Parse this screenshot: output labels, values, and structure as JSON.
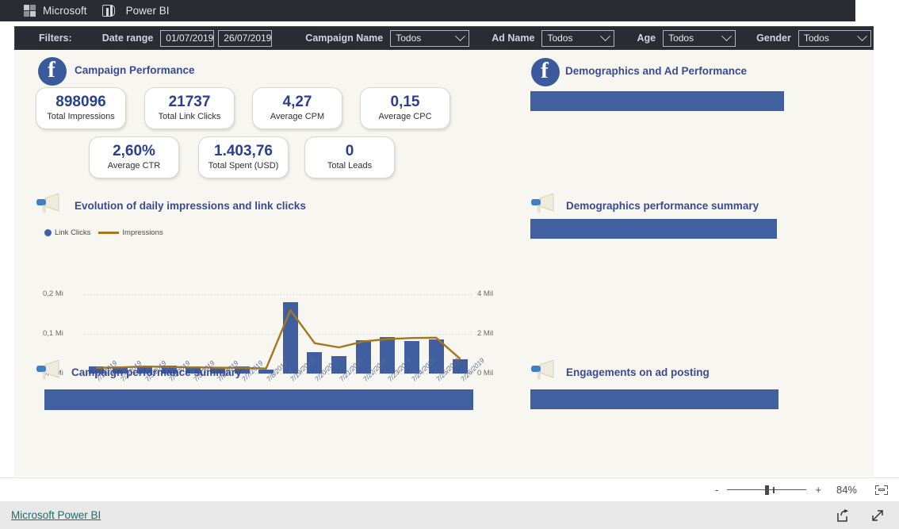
{
  "app_bar": {
    "microsoft": "Microsoft",
    "product": "Power BI",
    "ms_logo_icon": "microsoft-logo-icon",
    "pbi_icon": "power-bi-icon"
  },
  "filters": {
    "label": "Filters:",
    "date_range_label": "Date range",
    "date_from": "01/07/2019",
    "date_to": "26/07/2019",
    "campaign_name_label": "Campaign Name",
    "campaign_name_value": "Todos",
    "ad_name_label": "Ad Name",
    "ad_name_value": "Todos",
    "age_label": "Age",
    "age_value": "Todos",
    "gender_label": "Gender",
    "gender_value": "Todos"
  },
  "left": {
    "campaign_performance_title": "Campaign Performance",
    "facebook_icon": "facebook-icon",
    "kpis": [
      {
        "value": "898096",
        "label": "Total Impressions"
      },
      {
        "value": "21737",
        "label": "Total Link Clicks"
      },
      {
        "value": "4,27",
        "label": "Average CPM"
      },
      {
        "value": "0,15",
        "label": "Average CPC"
      },
      {
        "value": "2,60%",
        "label": "Average CTR"
      },
      {
        "value": "1.403,76",
        "label": "Total Spent (USD)"
      },
      {
        "value": "0",
        "label": "Total Leads"
      }
    ],
    "evolution_title": "Evolution of daily impressions and link clicks",
    "evolution_icon": "megaphone-icon",
    "campaign_summary_title": "Campaign performance summary",
    "campaign_summary_icon": "megaphone-icon"
  },
  "right": {
    "demographics_title": "Demographics and Ad Performance",
    "demographics_icon": "facebook-icon",
    "demographics_summary_title": "Demographics performance summary",
    "demographics_summary_icon": "megaphone-icon",
    "engagements_title": "Engagements on ad posting",
    "engagements_icon": "megaphone-icon"
  },
  "chart_data": {
    "type": "bar",
    "title": "Evolution of daily impressions and link clicks",
    "xlabel": "",
    "ylabel": "",
    "grid": true,
    "legend_position": "top-left",
    "legend": [
      {
        "name": "Link Clicks",
        "marker": "dot",
        "color": "#3f5fa0"
      },
      {
        "name": "Impressions",
        "marker": "line",
        "color": "#a6761d"
      }
    ],
    "categories": [
      "7/1/2019",
      "7/2/2019",
      "7/3/2019",
      "7/4/2019",
      "7/5/2019",
      "7/6/2019",
      "7/7/2019",
      "7/8/2019",
      "7/19/2019",
      "7/20/2019",
      "7/21/2019",
      "7/22/2019",
      "7/23/2019",
      "7/24/2019",
      "7/25/2019",
      "7/26/2019"
    ],
    "left_axis": {
      "ticks": [
        "0,0 Mi",
        "0,1 Mi",
        "0,2 Mi"
      ],
      "values": [
        0,
        100000,
        200000
      ],
      "ylim": [
        0,
        230000
      ]
    },
    "right_axis": {
      "ticks": [
        "0 Mil",
        "2 Mil",
        "4 Mil"
      ],
      "values": [
        0,
        2000000,
        4000000
      ],
      "ylim": [
        0,
        4600000
      ]
    },
    "series": [
      {
        "name": "Link Clicks",
        "type": "bar",
        "axis": "left",
        "color": "#3f5fa0",
        "values": [
          20000,
          21000,
          18000,
          22000,
          21000,
          19000,
          21000,
          11000,
          206000,
          61000,
          50000,
          96000,
          106000,
          94000,
          100000,
          42000
        ]
      },
      {
        "name": "Impressions",
        "type": "line",
        "axis": "right",
        "color": "#a6761d",
        "values": [
          330000,
          360000,
          410000,
          380000,
          360000,
          340000,
          330000,
          290000,
          3680000,
          1760000,
          1520000,
          1860000,
          2000000,
          2060000,
          2080000,
          840000
        ]
      }
    ]
  },
  "zoom_bar": {
    "minus": "-",
    "plus": "+",
    "level": "84%",
    "fit_icon": "fit-to-page-icon",
    "slider": "zoom-slider"
  },
  "footer": {
    "link": "Microsoft Power BI",
    "share_icon": "share-icon",
    "fullscreen_icon": "fullscreen-icon"
  },
  "colors": {
    "accent_blue": "#3f5fa0",
    "title_blue": "#3b4b93",
    "impressions_gold": "#a6761d",
    "canvas_bg": "#f7f6f1",
    "chrome_dark": "#2b2b33",
    "link_teal": "#1a6e72"
  }
}
